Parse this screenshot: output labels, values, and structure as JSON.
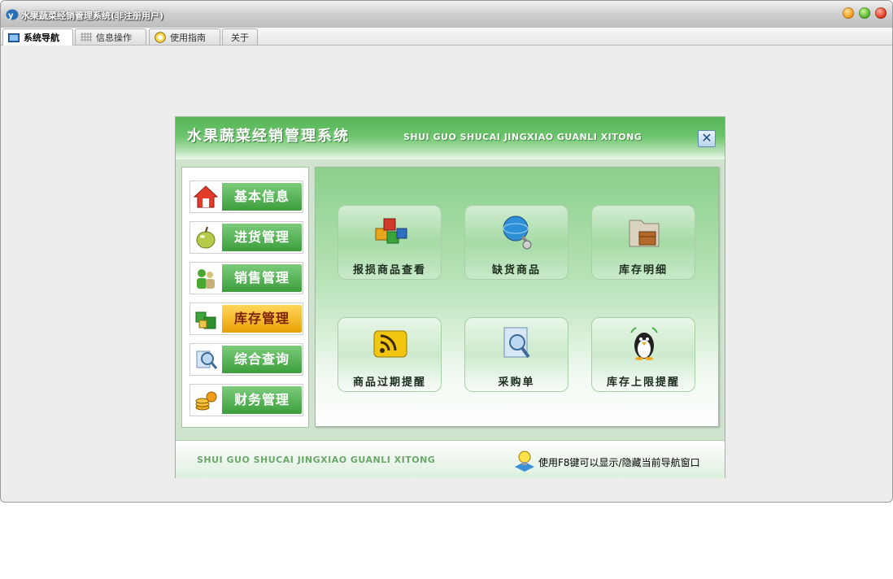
{
  "window": {
    "title": "水果蔬菜经销管理系统(非注册用户)"
  },
  "tabs": [
    {
      "label": "系统导航",
      "icon": "monitor-icon"
    },
    {
      "label": "信息操作",
      "icon": "grid-icon"
    },
    {
      "label": "使用指南",
      "icon": "guide-icon"
    },
    {
      "label": "关于"
    }
  ],
  "panel": {
    "title": "水果蔬菜经销管理系统",
    "subtitle": "SHUI GUO SHUCAI JINGXIAO GUANLI XITONG",
    "close_glyph": "✕"
  },
  "menu": [
    {
      "label": "基本信息",
      "icon": "house-icon"
    },
    {
      "label": "进货管理",
      "icon": "apple-icon"
    },
    {
      "label": "销售管理",
      "icon": "users-icon"
    },
    {
      "label": "库存管理",
      "icon": "boxes-icon",
      "active": true
    },
    {
      "label": "综合查询",
      "icon": "magnifier-icon"
    },
    {
      "label": "财务管理",
      "icon": "coins-icon"
    }
  ],
  "tiles": [
    {
      "label": "报损商品查看",
      "icon": "blocks-icon"
    },
    {
      "label": "缺货商品",
      "icon": "globe-icon"
    },
    {
      "label": "库存明细",
      "icon": "folder-box-icon"
    },
    {
      "label": "商品过期提醒",
      "icon": "rss-icon"
    },
    {
      "label": "采购单",
      "icon": "document-search-icon"
    },
    {
      "label": "库存上限提醒",
      "icon": "penguin-icon"
    }
  ],
  "footer": {
    "subtitle": "SHUI GUO SHUCAI JINGXIAO GUANLI XITONG",
    "tip": "使用F8键可以显示/隐藏当前导航窗口"
  },
  "colors": {
    "accent_green": "#4caf4c",
    "active_menu": "#f0b020"
  }
}
